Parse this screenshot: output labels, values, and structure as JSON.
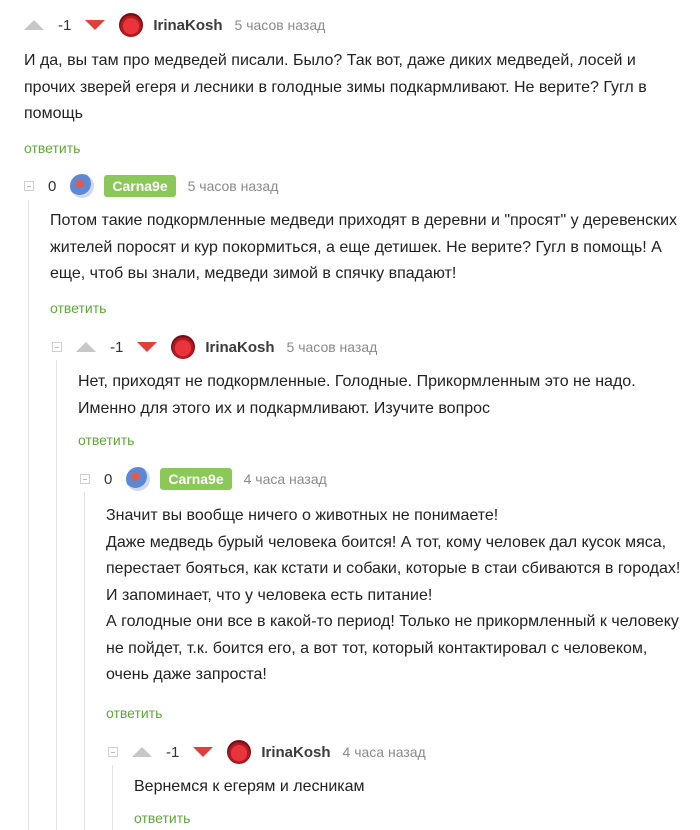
{
  "comments": [
    {
      "rating": "-1",
      "username": "IrinaKosh",
      "time": "5 часов назад",
      "text": [
        "И да, вы там про медведей писали. Было? Так вот, даже диких медведей, лосей и прочих зверей егеря и лесники в голодные зимы подкармливают. Не верите? Гугл в помощь"
      ],
      "reply": "ответить"
    },
    {
      "rating": "0",
      "username": "Carna9e",
      "time": "5 часов назад",
      "text": [
        "Потом такие подкормленные медведи приходят в деревни и \"просят\" у деревенских жителей поросят и кур покормиться, а еще детишек. Не верите? Гугл в помощь! А еще, чтоб вы знали, медведи зимой в спячку впадают!"
      ],
      "reply": "ответить"
    },
    {
      "rating": "-1",
      "username": "IrinaKosh",
      "time": "5 часов назад",
      "text": [
        "Нет, приходят не подкормленные. Голодные. Прикормленным это не надо. Именно для этого их и подкармливают. Изучите вопрос"
      ],
      "reply": "ответить"
    },
    {
      "rating": "0",
      "username": "Carna9e",
      "time": "4 часа назад",
      "text": [
        "Значит вы вообще ничего о животных не понимаете!",
        "Даже медведь бурый человека боится! А тот, кому человек дал кусок мяса, перестает бояться, как кстати и собаки, которые в стаи сбиваются в городах! И запоминает, что у человека есть питание!",
        "А голодные они все в какой-то период! Только не прикормленный к человеку не пойдет, т.к. боится его, а вот тот, который контактировал с человеком, очень даже запроста!"
      ],
      "reply": "ответить"
    },
    {
      "rating": "-1",
      "username": "IrinaKosh",
      "time": "4 часа назад",
      "text": [
        "Вернемся к егерям и лесникам"
      ],
      "reply": "ответить"
    }
  ]
}
